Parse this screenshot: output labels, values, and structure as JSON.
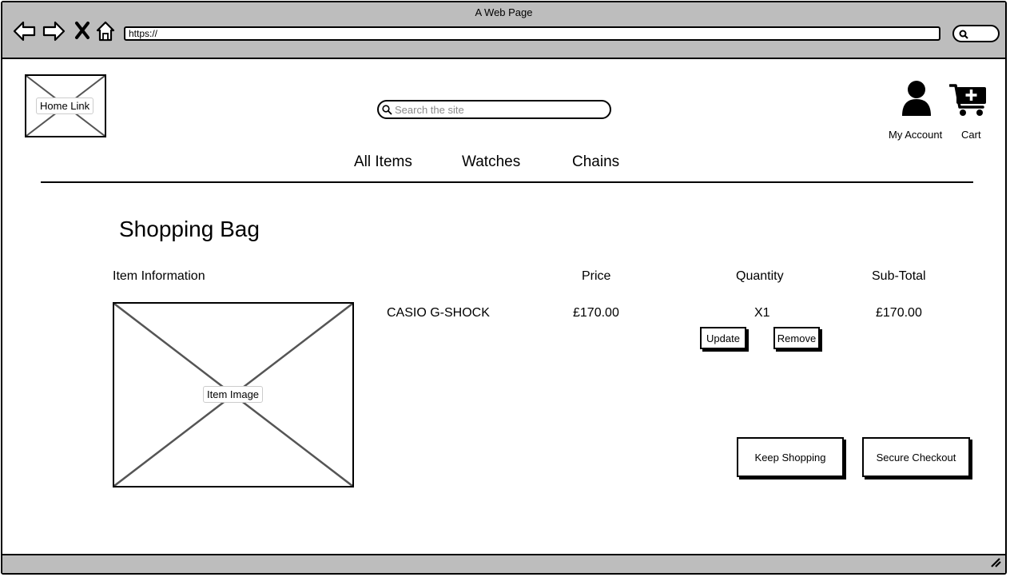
{
  "browser": {
    "title": "A Web Page",
    "url": "https://"
  },
  "header": {
    "home_link": "Home Link",
    "search_placeholder": "Search the site",
    "account_label": "My Account",
    "cart_label": "Cart"
  },
  "nav": {
    "items": [
      {
        "label": "All Items"
      },
      {
        "label": "Watches"
      },
      {
        "label": "Chains"
      }
    ]
  },
  "bag": {
    "title": "Shopping Bag",
    "columns": {
      "item": "Item Information",
      "price": "Price",
      "quantity": "Quantity",
      "subtotal": "Sub-Total"
    },
    "items": [
      {
        "image_label": "Item Image",
        "name": "CASIO G-SHOCK",
        "price": "£170.00",
        "quantity": "X1",
        "subtotal": "£170.00",
        "update_label": "Update",
        "remove_label": "Remove"
      }
    ],
    "keep_shopping_label": "Keep Shopping",
    "checkout_label": "Secure Checkout"
  }
}
